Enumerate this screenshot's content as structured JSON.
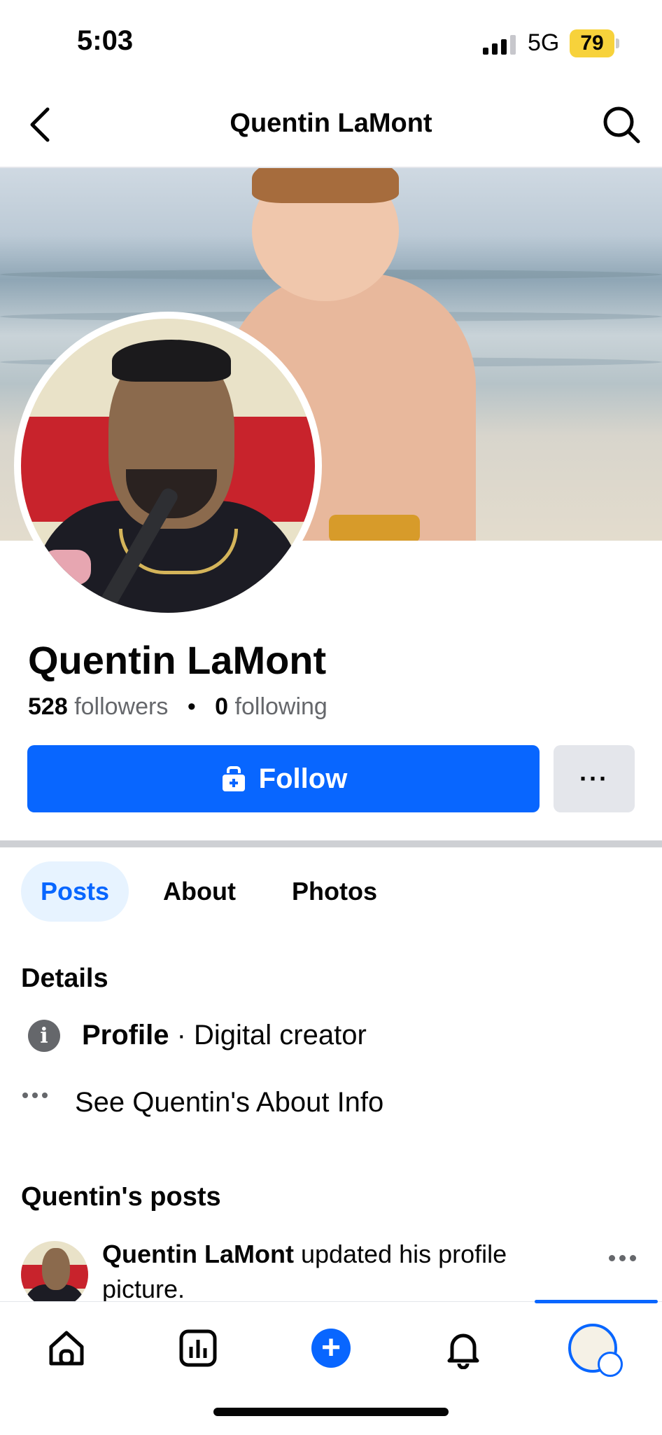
{
  "status_bar": {
    "time": "5:03",
    "network": "5G",
    "battery": "79"
  },
  "header": {
    "title": "Quentin LaMont",
    "back_icon": "chevron-left-icon",
    "search_icon": "search-icon"
  },
  "profile": {
    "name": "Quentin LaMont",
    "followers_count": "528",
    "followers_label": "followers",
    "following_count": "0",
    "following_label": "following",
    "separator": "•"
  },
  "actions": {
    "follow_label": "Follow",
    "more_label": "···"
  },
  "tabs": [
    {
      "label": "Posts",
      "active": true
    },
    {
      "label": "About",
      "active": false
    },
    {
      "label": "Photos",
      "active": false
    }
  ],
  "details": {
    "heading": "Details",
    "profile_label": "Profile",
    "profile_value": " · Digital creator",
    "about_link": "See Quentin's About Info"
  },
  "posts": {
    "heading": "Quentin's posts",
    "items": [
      {
        "author": "Quentin LaMont",
        "text": " updated his profile picture."
      }
    ]
  },
  "bottom_nav": {
    "items": [
      "home-icon",
      "dashboard-icon",
      "create-icon",
      "notifications-icon",
      "profile-icon"
    ],
    "active": "profile-icon"
  },
  "colors": {
    "accent": "#0866ff",
    "secondary_button": "#e4e6eb",
    "muted_text": "#65676b",
    "battery": "#f7d23b"
  }
}
